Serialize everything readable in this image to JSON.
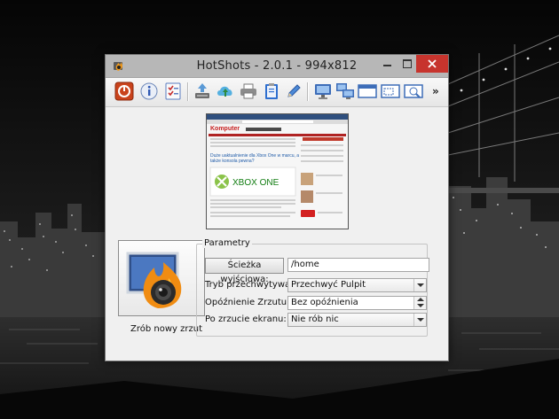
{
  "window": {
    "title": "HotShots - 2.0.1 - 994x812",
    "app_icon": "hotshots-app-icon",
    "controls": [
      "minimize-icon",
      "maximize-icon",
      "close-icon"
    ]
  },
  "toolbar": {
    "tools": [
      {
        "name": "quit-tool",
        "icon": "power-icon"
      },
      {
        "name": "about-tool",
        "icon": "info-icon"
      },
      {
        "name": "preferences-tool",
        "icon": "checklist-icon"
      },
      {
        "name": "save-tool",
        "icon": "save-icon"
      },
      {
        "name": "upload-tool",
        "icon": "cloud-upload-icon"
      },
      {
        "name": "print-tool",
        "icon": "printer-icon"
      },
      {
        "name": "copy-tool",
        "icon": "clipboard-icon"
      },
      {
        "name": "edit-tool",
        "icon": "pencil-icon"
      },
      {
        "name": "screen-capture-tool",
        "icon": "monitor-icon"
      },
      {
        "name": "all-screens-tool",
        "icon": "multi-monitor-icon"
      },
      {
        "name": "window-capture-tool",
        "icon": "window-icon"
      },
      {
        "name": "region-capture-tool",
        "icon": "region-icon"
      },
      {
        "name": "freehand-capture-tool",
        "icon": "freehand-icon"
      }
    ],
    "overflow": "»"
  },
  "preview": {
    "site_logo": "Komputer",
    "headline": "Duże uaktualnienie dla Xbox One w marcu, a także konsola pewna?",
    "banner": "XBOX ONE"
  },
  "capture": {
    "label": "Zrób nowy zrzut",
    "icon": "camera-flame-icon"
  },
  "params": {
    "legend": "Parametry",
    "output_button": "Ścieżka wyjściowa:",
    "output_path": "/home",
    "mode_label": "Tryb przechwytywania:",
    "mode_value": "Przechwyć Pulpit",
    "delay_label": "Opóźnienie Zrzutu (s):",
    "delay_value": "Bez opóźnienia",
    "after_label": "Po zrzucie ekranu:",
    "after_value": "Nie rób nic"
  }
}
